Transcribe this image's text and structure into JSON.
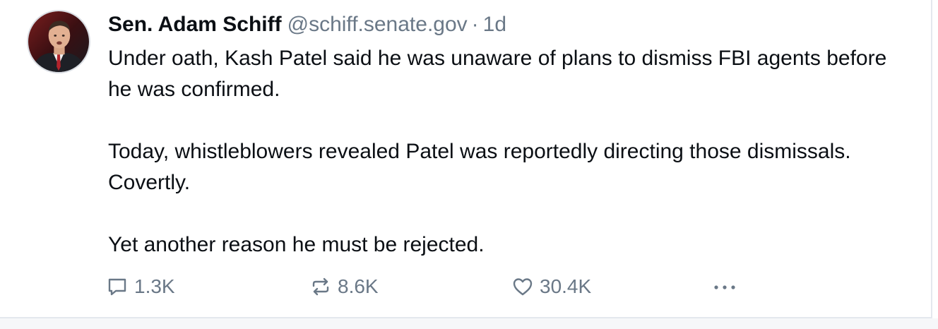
{
  "post": {
    "author": {
      "display_name": "Sen. Adam Schiff",
      "handle": "@schiff.senate.gov",
      "separator": "·",
      "timestamp": "1d"
    },
    "paragraphs": [
      "Under oath, Kash Patel said he was unaware of plans to dismiss FBI agents before he was confirmed.",
      "Today, whistleblowers revealed Patel was reportedly directing those dismissals. Covertly.",
      "Yet another reason he must be rejected."
    ],
    "actions": {
      "reply": {
        "icon": "reply-icon",
        "count": "1.3K"
      },
      "repost": {
        "icon": "repost-icon",
        "count": "8.6K"
      },
      "like": {
        "icon": "heart-icon",
        "count": "30.4K"
      },
      "more": {
        "icon": "more-icon"
      }
    }
  },
  "colors": {
    "text": "#0b0f14",
    "muted": "#6a7887",
    "border": "#e4e8ee"
  }
}
